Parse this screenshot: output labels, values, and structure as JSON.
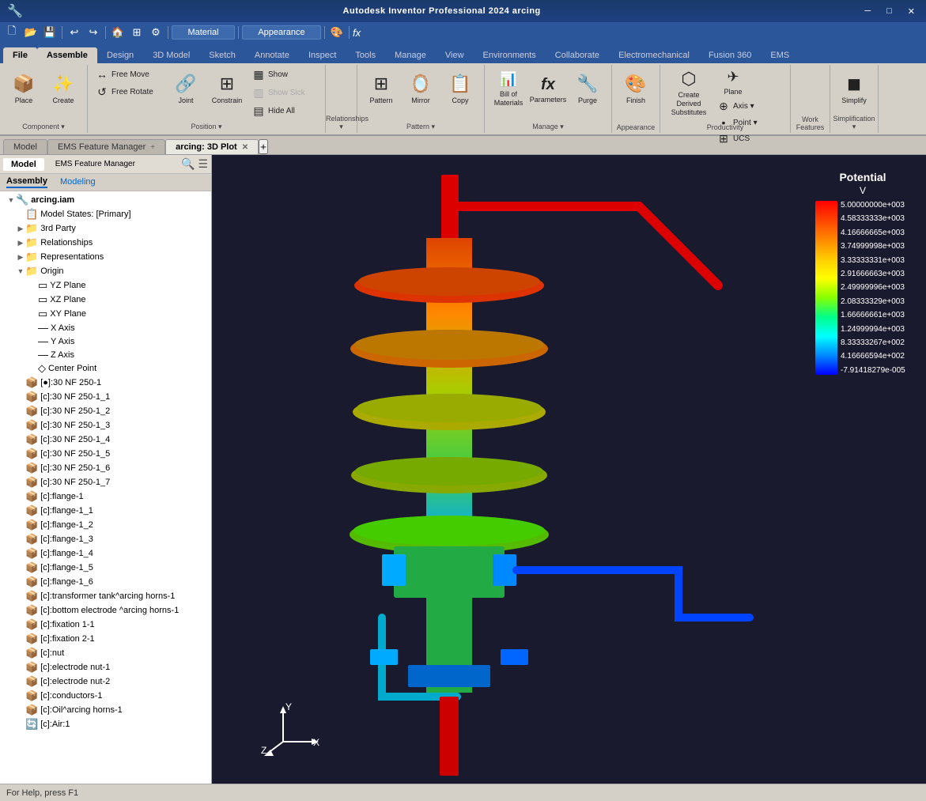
{
  "app": {
    "title": "Autodesk Inventor Professional 2024  arcing",
    "status_bar": "For Help, press F1"
  },
  "titlebar": {
    "left_icons": [
      "save",
      "undo",
      "redo",
      "new",
      "open"
    ],
    "material_label": "Material",
    "appearance_label": "Appearance",
    "fx_label": "fx"
  },
  "ribbon_tabs": [
    {
      "label": "File",
      "active": false
    },
    {
      "label": "Assemble",
      "active": true
    },
    {
      "label": "Design",
      "active": false
    },
    {
      "label": "3D Model",
      "active": false
    },
    {
      "label": "Sketch",
      "active": false
    },
    {
      "label": "Annotate",
      "active": false
    },
    {
      "label": "Inspect",
      "active": false
    },
    {
      "label": "Tools",
      "active": false
    },
    {
      "label": "Manage",
      "active": false
    },
    {
      "label": "View",
      "active": false
    },
    {
      "label": "Environments",
      "active": false
    },
    {
      "label": "Collaborate",
      "active": false
    },
    {
      "label": "Electromechanical",
      "active": false
    },
    {
      "label": "Fusion 360",
      "active": false
    },
    {
      "label": "EMS",
      "active": false
    }
  ],
  "ribbon": {
    "groups": [
      {
        "label": "Component",
        "buttons": [
          {
            "type": "large",
            "icon": "📦",
            "label": "Place"
          },
          {
            "type": "large",
            "icon": "✨",
            "label": "Create"
          }
        ]
      },
      {
        "label": "Position",
        "buttons": [
          {
            "type": "large",
            "icon": "🔗",
            "label": "Joint"
          },
          {
            "type": "large",
            "icon": "⊞",
            "label": "Constrain"
          },
          {
            "type": "small",
            "icon": "↔",
            "label": "Free Move"
          },
          {
            "type": "small",
            "icon": "↺",
            "label": "Free Rotate"
          }
        ],
        "small_right": [
          {
            "icon": "▦",
            "label": "Show"
          },
          {
            "icon": "▥",
            "label": "Show Sick"
          },
          {
            "icon": "▤",
            "label": "Hide All"
          }
        ]
      },
      {
        "label": "Pattern",
        "buttons": [
          {
            "type": "large",
            "icon": "⊞",
            "label": "Pattern"
          },
          {
            "type": "large",
            "icon": "🪞",
            "label": "Mirror"
          },
          {
            "type": "large",
            "icon": "📋",
            "label": "Copy"
          }
        ]
      },
      {
        "label": "Manage",
        "buttons": [
          {
            "type": "large",
            "icon": "📊",
            "label": "Bill of\nMaterials"
          },
          {
            "type": "large",
            "icon": "fx",
            "label": "Parameters"
          },
          {
            "type": "large",
            "icon": "🔧",
            "label": "Purge"
          }
        ]
      },
      {
        "label": "Appearance",
        "buttons": [
          {
            "type": "large",
            "icon": "🎨",
            "label": "Finish"
          }
        ]
      },
      {
        "label": "Productivity",
        "buttons": [
          {
            "type": "large",
            "icon": "⬡",
            "label": "Create Derived\nSubstitutes"
          },
          {
            "type": "large",
            "icon": "✈",
            "label": "Plane"
          }
        ],
        "small": [
          {
            "icon": "⊕",
            "label": "Axis"
          },
          {
            "icon": "•",
            "label": "Point"
          },
          {
            "icon": "⊞",
            "label": "UCS"
          }
        ]
      },
      {
        "label": "Work Features",
        "buttons": []
      },
      {
        "label": "Simplification",
        "buttons": [
          {
            "type": "large",
            "icon": "◼",
            "label": "Simplify"
          }
        ]
      }
    ]
  },
  "doc_tabs": [
    {
      "label": "Model",
      "active": false
    },
    {
      "label": "EMS Feature Manager",
      "active": false
    },
    {
      "label": "arcing: 3D Plot",
      "active": true
    }
  ],
  "tree_subtabs": [
    {
      "label": "Assembly",
      "active": true
    },
    {
      "label": "Modeling",
      "active": false
    }
  ],
  "tree": {
    "root": "arcing.iam",
    "items": [
      {
        "indent": 0,
        "toggle": "",
        "icon": "📁",
        "label": "arcing.iam",
        "level": 0
      },
      {
        "indent": 1,
        "toggle": "",
        "icon": "📋",
        "label": "Model States: [Primary]",
        "level": 1
      },
      {
        "indent": 1,
        "toggle": "",
        "icon": "📁",
        "label": "3rd Party",
        "level": 1
      },
      {
        "indent": 1,
        "toggle": "",
        "icon": "📁",
        "label": "Relationships",
        "level": 1
      },
      {
        "indent": 1,
        "toggle": "",
        "icon": "📁",
        "label": "Representations",
        "level": 1
      },
      {
        "indent": 1,
        "toggle": "▶",
        "icon": "📁",
        "label": "Origin",
        "level": 1
      },
      {
        "indent": 2,
        "toggle": "",
        "icon": "▭",
        "label": "YZ Plane",
        "level": 2
      },
      {
        "indent": 2,
        "toggle": "",
        "icon": "▭",
        "label": "XZ Plane",
        "level": 2
      },
      {
        "indent": 2,
        "toggle": "",
        "icon": "▭",
        "label": "XY Plane",
        "level": 2
      },
      {
        "indent": 2,
        "toggle": "",
        "icon": "—",
        "label": "X Axis",
        "level": 2
      },
      {
        "indent": 2,
        "toggle": "",
        "icon": "—",
        "label": "Y Axis",
        "level": 2
      },
      {
        "indent": 2,
        "toggle": "",
        "icon": "—",
        "label": "Z Axis",
        "level": 2
      },
      {
        "indent": 2,
        "toggle": "",
        "icon": "◇",
        "label": "Center Point",
        "level": 2
      },
      {
        "indent": 1,
        "toggle": "",
        "icon": "📦",
        "label": "[●]:30 NF 250-1",
        "level": 1
      },
      {
        "indent": 1,
        "toggle": "",
        "icon": "📦",
        "label": "[c]:30 NF 250-1_1",
        "level": 1
      },
      {
        "indent": 1,
        "toggle": "",
        "icon": "📦",
        "label": "[c]:30 NF 250-1_2",
        "level": 1
      },
      {
        "indent": 1,
        "toggle": "",
        "icon": "📦",
        "label": "[c]:30 NF 250-1_3",
        "level": 1
      },
      {
        "indent": 1,
        "toggle": "",
        "icon": "📦",
        "label": "[c]:30 NF 250-1_4",
        "level": 1
      },
      {
        "indent": 1,
        "toggle": "",
        "icon": "📦",
        "label": "[c]:30 NF 250-1_5",
        "level": 1
      },
      {
        "indent": 1,
        "toggle": "",
        "icon": "📦",
        "label": "[c]:30 NF 250-1_6",
        "level": 1
      },
      {
        "indent": 1,
        "toggle": "",
        "icon": "📦",
        "label": "[c]:30 NF 250-1_7",
        "level": 1
      },
      {
        "indent": 1,
        "toggle": "",
        "icon": "📦",
        "label": "[c]:flange-1",
        "level": 1
      },
      {
        "indent": 1,
        "toggle": "",
        "icon": "📦",
        "label": "[c]:flange-1_1",
        "level": 1
      },
      {
        "indent": 1,
        "toggle": "",
        "icon": "📦",
        "label": "[c]:flange-1_2",
        "level": 1
      },
      {
        "indent": 1,
        "toggle": "",
        "icon": "📦",
        "label": "[c]:flange-1_3",
        "level": 1
      },
      {
        "indent": 1,
        "toggle": "",
        "icon": "📦",
        "label": "[c]:flange-1_4",
        "level": 1
      },
      {
        "indent": 1,
        "toggle": "",
        "icon": "📦",
        "label": "[c]:flange-1_5",
        "level": 1
      },
      {
        "indent": 1,
        "toggle": "",
        "icon": "📦",
        "label": "[c]:flange-1_6",
        "level": 1
      },
      {
        "indent": 1,
        "toggle": "",
        "icon": "📦",
        "label": "[c]:transformer tank^arcing horns-1",
        "level": 1
      },
      {
        "indent": 1,
        "toggle": "",
        "icon": "📦",
        "label": "[c]:bottom electrode ^arcing horns-1",
        "level": 1
      },
      {
        "indent": 1,
        "toggle": "",
        "icon": "📦",
        "label": "[c]:fixation 1-1",
        "level": 1
      },
      {
        "indent": 1,
        "toggle": "",
        "icon": "📦",
        "label": "[c]:fixation 2-1",
        "level": 1
      },
      {
        "indent": 1,
        "toggle": "",
        "icon": "📦",
        "label": "[c]:nut",
        "level": 1
      },
      {
        "indent": 1,
        "toggle": "",
        "icon": "📦",
        "label": "[c]:electrode nut-1",
        "level": 1
      },
      {
        "indent": 1,
        "toggle": "",
        "icon": "📦",
        "label": "[c]:electrode nut-2",
        "level": 1
      },
      {
        "indent": 1,
        "toggle": "",
        "icon": "📦",
        "label": "[c]:conductors-1",
        "level": 1
      },
      {
        "indent": 1,
        "toggle": "",
        "icon": "📦",
        "label": "[c]:Oil^arcing horns-1",
        "level": 1
      },
      {
        "indent": 1,
        "toggle": "",
        "icon": "🔄",
        "label": "[c]:Air:1",
        "level": 1
      }
    ]
  },
  "legend": {
    "title": "Potential",
    "unit": "V",
    "values": [
      "5.00000000e+003",
      "4.58333333e+003",
      "4.16666665e+003",
      "3.74999998e+003",
      "3.33333331e+003",
      "2.91666663e+003",
      "2.49999996e+003",
      "2.08333329e+003",
      "1.66666661e+003",
      "1.24999994e+003",
      "8.33333267e+002",
      "4.16666594e+002",
      "-7.91418279e-005"
    ]
  },
  "viewport_bg": "#1a1a2e",
  "status_bar_text": "For Help, press F1"
}
